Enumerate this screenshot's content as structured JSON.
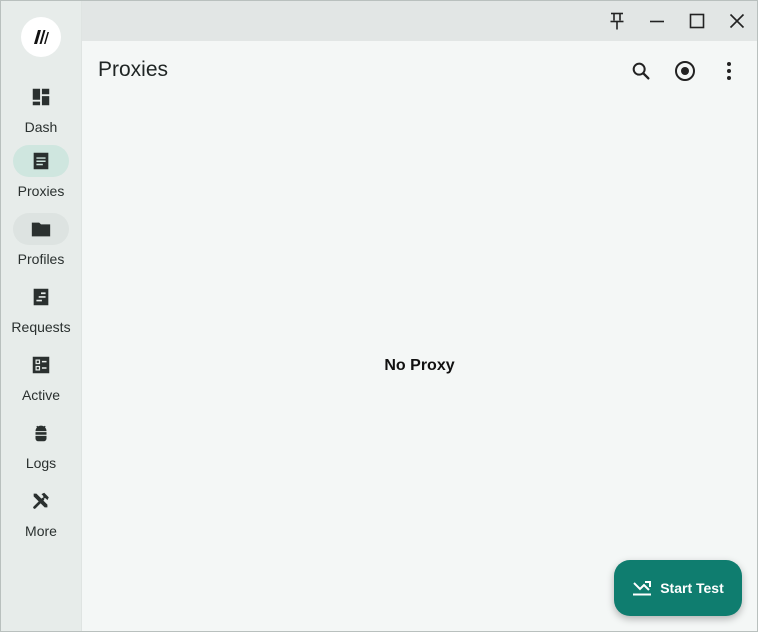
{
  "nav": {
    "items": [
      {
        "label": "Dash",
        "icon": "dashboard-icon"
      },
      {
        "label": "Proxies",
        "icon": "proxies-list-icon",
        "active": true
      },
      {
        "label": "Profiles",
        "icon": "folder-icon"
      },
      {
        "label": "Requests",
        "icon": "requests-icon"
      },
      {
        "label": "Active",
        "icon": "connections-icon"
      },
      {
        "label": "Logs",
        "icon": "android-bug-icon"
      },
      {
        "label": "More",
        "icon": "tools-icon"
      }
    ]
  },
  "titlebar": {
    "buttons": [
      "pin-icon",
      "minimize-icon",
      "maximize-icon",
      "close-icon"
    ]
  },
  "main": {
    "title": "Proxies",
    "actions": [
      "search-icon",
      "radio-target-icon",
      "more-vert-icon"
    ],
    "empty_text": "No Proxy"
  },
  "fab": {
    "label": "Start Test",
    "icon": "speed-test-icon"
  },
  "colors": {
    "accent": "#0f7d6f",
    "active_pill": "#cfe6df",
    "rail_bg": "#e7ecea",
    "main_bg": "#f4f7f6"
  }
}
